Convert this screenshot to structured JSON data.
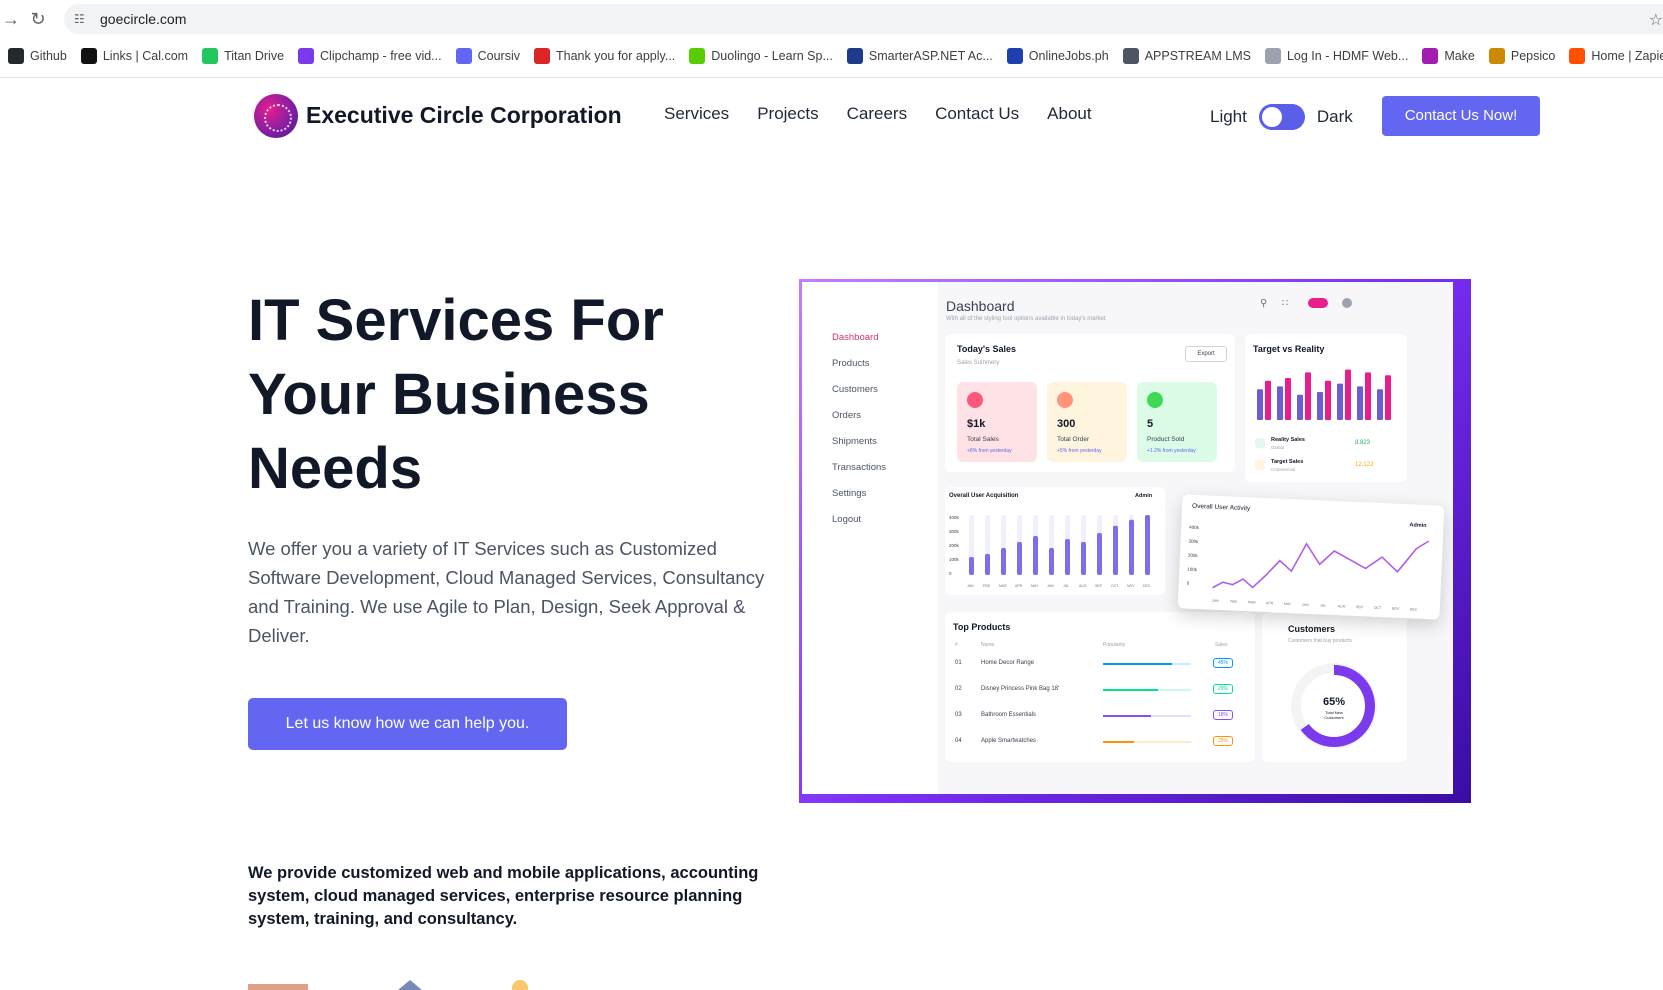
{
  "browser": {
    "url": "goecircle.com",
    "bookmarks": [
      {
        "label": "Github",
        "icon": "github-icon",
        "color": "#24292e"
      },
      {
        "label": "Links | Cal.com",
        "icon": "calcom-icon",
        "color": "#111111"
      },
      {
        "label": "Titan Drive",
        "icon": "titan-drive-icon",
        "color": "#22c55e"
      },
      {
        "label": "Clipchamp - free vid...",
        "icon": "clipchamp-icon",
        "color": "#7c3aed"
      },
      {
        "label": "Coursiv",
        "icon": "coursiv-icon",
        "color": "#6366f1"
      },
      {
        "label": "Thank you for apply...",
        "icon": "application-icon",
        "color": "#dc2626"
      },
      {
        "label": "Duolingo - Learn Sp...",
        "icon": "duolingo-icon",
        "color": "#58cc02"
      },
      {
        "label": "SmarterASP.NET Ac...",
        "icon": "smarterasp-icon",
        "color": "#1e3a8a"
      },
      {
        "label": "OnlineJobs.ph",
        "icon": "onlinejobs-icon",
        "color": "#1e40af"
      },
      {
        "label": "APPSTREAM LMS",
        "icon": "globe-icon",
        "color": "#4b5563"
      },
      {
        "label": "Log In - HDMF Web...",
        "icon": "document-icon",
        "color": "#9ca3af"
      },
      {
        "label": "Make",
        "icon": "make-icon",
        "color": "#a21caf"
      },
      {
        "label": "Pepsico",
        "icon": "pepsico-icon",
        "color": "#ca8a04"
      },
      {
        "label": "Home | Zapier",
        "icon": "zapier-icon",
        "color": "#ff4f00"
      }
    ]
  },
  "header": {
    "brand": "Executive Circle Corporation",
    "nav": [
      "Services",
      "Projects",
      "Careers",
      "Contact Us",
      "About"
    ],
    "theme_light": "Light",
    "theme_dark": "Dark",
    "cta": "Contact Us Now!"
  },
  "hero": {
    "title_lines": [
      "IT Services For",
      "Your Business",
      "Needs"
    ],
    "description": "We offer you a variety of IT Services such as Customized Software Development, Cloud Managed Services, Consultancy and Training. We use Agile to Plan, Design, Seek Approval & Deliver.",
    "button": "Let us know how we can help you.",
    "subtext": "We provide customized web and mobile applications, accounting system, cloud managed services, enterprise resource planning system, training, and consultancy."
  },
  "dashboard": {
    "title": "Dashboard",
    "subtitle": "With all of the styling tool options available in today's market",
    "sidebar": [
      "Dashboard",
      "Products",
      "Customers",
      "Orders",
      "Shipments",
      "Transactions",
      "Settings",
      "Logout"
    ],
    "todays_sales": {
      "title": "Today's Sales",
      "subtitle": "Sales Summery",
      "export": "Export",
      "stats": [
        {
          "value": "$1k",
          "label": "Total Sales",
          "sub": "+8% from yesterday",
          "bg": "#ffe2e5",
          "icon_color": "#fa5a7d"
        },
        {
          "value": "300",
          "label": "Total Order",
          "sub": "+5% from yesterday",
          "bg": "#fff4de",
          "icon_color": "#ff947a"
        },
        {
          "value": "5",
          "label": "Product Sold",
          "sub": "+1.2% from yesterday",
          "bg": "#dcfce7",
          "icon_color": "#3cd856"
        }
      ]
    },
    "target_vs_reality": {
      "title": "Target vs Reality",
      "reality_label": "Reality Sales",
      "reality_sub": "Global",
      "reality_value": "8.823",
      "target_label": "Target Sales",
      "target_sub": "Commercial",
      "target_value": "12.122"
    },
    "acquisition": {
      "title": "Overall User Acquisition",
      "filter": "Admin"
    },
    "activity": {
      "title": "Overall User Activity",
      "filter": "Admin"
    },
    "top_products": {
      "title": "Top Products",
      "headers": [
        "#",
        "Name",
        "Popularity",
        "Sales"
      ],
      "rows": [
        {
          "num": "01",
          "name": "Home Decor Range",
          "pct": "45%",
          "color": "#0095ff",
          "fill": 0.78
        },
        {
          "num": "02",
          "name": "Disney Princess Pink Bag 18'",
          "pct": "29%",
          "color": "#00e096",
          "fill": 0.62
        },
        {
          "num": "03",
          "name": "Bathroom Essentials",
          "pct": "18%",
          "color": "#884dff",
          "fill": 0.55
        },
        {
          "num": "04",
          "name": "Apple Smartwatches",
          "pct": "25%",
          "color": "#ff8f0d",
          "fill": 0.35
        }
      ]
    },
    "customers": {
      "title": "Customers",
      "subtitle": "Customers that buy products",
      "value": "65%",
      "label": "Total New Customers"
    },
    "months": [
      "JAN",
      "FEB",
      "MAR",
      "APR",
      "MAY",
      "JUN",
      "JUL",
      "AUG",
      "SEP",
      "OCT",
      "NOV",
      "DEC"
    ]
  },
  "colors": {
    "accent": "#6366f1",
    "pink": "#e91e8c",
    "purple": "#7c3aed"
  }
}
